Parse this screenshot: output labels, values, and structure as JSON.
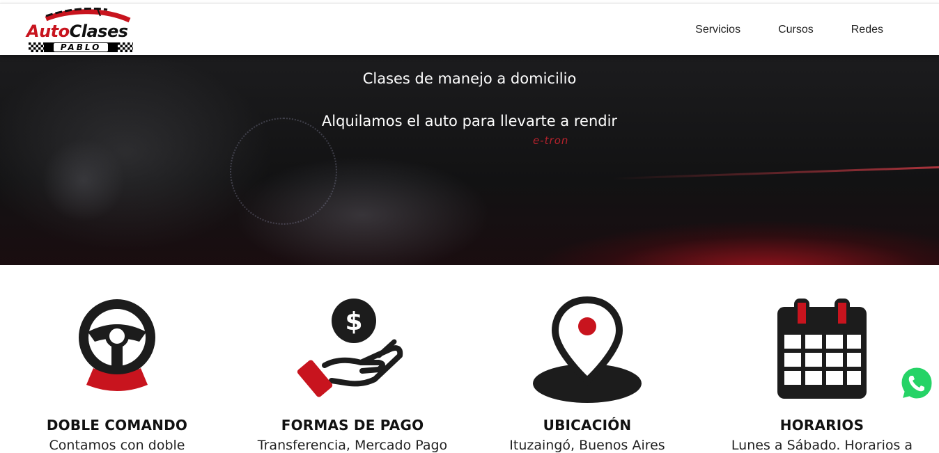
{
  "brand": {
    "logo_word1": "Auto",
    "logo_word2": "Clases",
    "logo_sub": "PABLO",
    "accent_color": "#c8141e"
  },
  "nav": {
    "items": [
      {
        "label": "Servicios"
      },
      {
        "label": "Cursos"
      },
      {
        "label": "Redes"
      }
    ]
  },
  "hero": {
    "line1": "Clases de manejo a domicilio",
    "line2": "Alquilamos el auto para llevarte a rendir",
    "car_badge": "e-tron"
  },
  "features": [
    {
      "icon": "steering-wheel-icon",
      "title": "DOBLE COMANDO",
      "text": "Contamos con doble"
    },
    {
      "icon": "payment-hand-icon",
      "title": "FORMAS DE PAGO",
      "text": "Transferencia, Mercado Pago"
    },
    {
      "icon": "location-pin-icon",
      "title": "UBICACIÓN",
      "text": "Ituzaingó, Buenos Aires"
    },
    {
      "icon": "calendar-icon",
      "title": "HORARIOS",
      "text": "Lunes a Sábado. Horarios a"
    }
  ],
  "whatsapp": {
    "icon": "whatsapp-icon",
    "color": "#25d366"
  }
}
